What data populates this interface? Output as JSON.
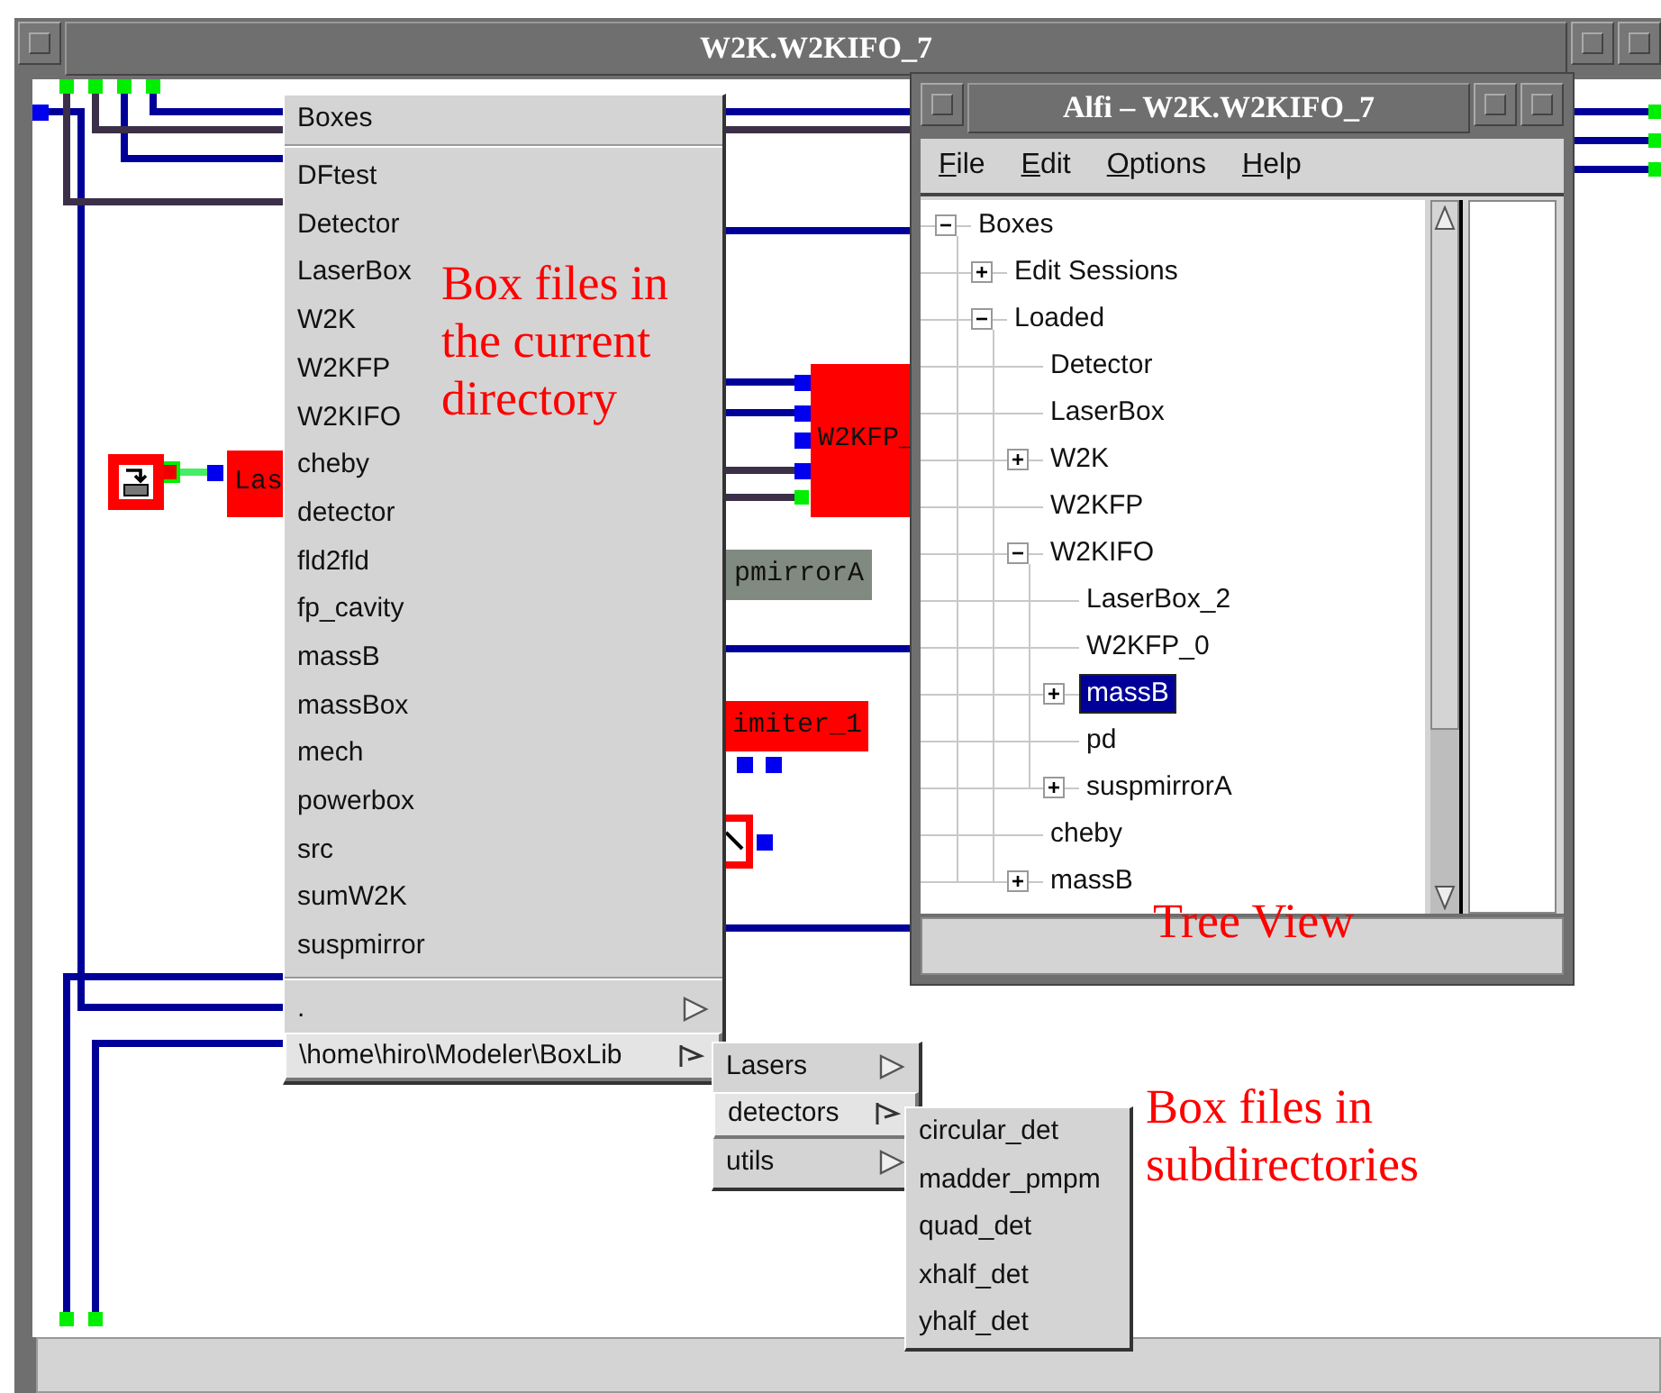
{
  "main_window": {
    "title": "W2K.W2KIFO_7"
  },
  "canvas_blocks": [
    {
      "label": "Las",
      "color": "#ff0000"
    },
    {
      "label": "W2KFP_",
      "color": "#ff0000"
    },
    {
      "label": "pmirrorA",
      "color": "#808a80"
    },
    {
      "label": "imiter_1",
      "color": "#ff0000"
    }
  ],
  "boxes_menu": {
    "title": "Boxes",
    "items": [
      {
        "label": "DFtest",
        "kind": "file",
        "selected": false
      },
      {
        "label": "Detector",
        "kind": "file",
        "selected": false
      },
      {
        "label": "LaserBox",
        "kind": "file",
        "selected": false
      },
      {
        "label": "W2K",
        "kind": "file",
        "selected": false
      },
      {
        "label": "W2KFP",
        "kind": "file",
        "selected": false
      },
      {
        "label": "W2KIFO",
        "kind": "file",
        "selected": false
      },
      {
        "label": "cheby",
        "kind": "file",
        "selected": false
      },
      {
        "label": "detector",
        "kind": "file",
        "selected": false
      },
      {
        "label": "fld2fld",
        "kind": "file",
        "selected": false
      },
      {
        "label": "fp_cavity",
        "kind": "file",
        "selected": false
      },
      {
        "label": "massB",
        "kind": "file",
        "selected": false
      },
      {
        "label": "massBox",
        "kind": "file",
        "selected": false
      },
      {
        "label": "mech",
        "kind": "file",
        "selected": false
      },
      {
        "label": "powerbox",
        "kind": "file",
        "selected": false
      },
      {
        "label": "src",
        "kind": "file",
        "selected": false
      },
      {
        "label": "sumW2K",
        "kind": "file",
        "selected": false
      },
      {
        "label": "suspmirror",
        "kind": "file",
        "selected": false
      },
      {
        "label": ".",
        "kind": "folder",
        "selected": false
      },
      {
        "label": "\\home\\hiro\\Modeler\\BoxLib",
        "kind": "folder",
        "selected": true
      }
    ]
  },
  "folder_submenu": {
    "items": [
      {
        "label": "Lasers",
        "kind": "folder",
        "selected": false
      },
      {
        "label": "detectors",
        "kind": "folder",
        "selected": true
      },
      {
        "label": "utils",
        "kind": "folder",
        "selected": false
      }
    ]
  },
  "detectors_submenu": {
    "items": [
      {
        "label": "circular_det",
        "kind": "file",
        "selected": false
      },
      {
        "label": "madder_pmpm",
        "kind": "file",
        "selected": false
      },
      {
        "label": "quad_det",
        "kind": "file",
        "selected": false
      },
      {
        "label": "xhalf_det",
        "kind": "file",
        "selected": false
      },
      {
        "label": "yhalf_det",
        "kind": "file",
        "selected": false
      }
    ]
  },
  "alfi_window": {
    "title": "Alfi – W2K.W2KIFO_7",
    "menu": [
      "File",
      "Edit",
      "Options",
      "Help"
    ],
    "tree": [
      {
        "label": "Boxes",
        "kind": "branch",
        "expanded": true,
        "selected": false,
        "children": [
          {
            "label": "Edit Sessions",
            "kind": "branch",
            "expanded": false,
            "selected": false
          },
          {
            "label": "Loaded",
            "kind": "branch",
            "expanded": true,
            "selected": false,
            "children": [
              {
                "label": "Detector",
                "kind": "leaf",
                "selected": false
              },
              {
                "label": "LaserBox",
                "kind": "leaf",
                "selected": false
              },
              {
                "label": "W2K",
                "kind": "branch",
                "expanded": false,
                "selected": false
              },
              {
                "label": "W2KFP",
                "kind": "leaf",
                "selected": false
              },
              {
                "label": "W2KIFO",
                "kind": "branch",
                "expanded": true,
                "selected": false,
                "children": [
                  {
                    "label": "LaserBox_2",
                    "kind": "leaf",
                    "selected": false
                  },
                  {
                    "label": "W2KFP_0",
                    "kind": "leaf",
                    "selected": false
                  },
                  {
                    "label": "massB",
                    "kind": "branch",
                    "expanded": false,
                    "selected": true
                  },
                  {
                    "label": "pd",
                    "kind": "leaf",
                    "selected": false
                  },
                  {
                    "label": "suspmirrorA",
                    "kind": "branch",
                    "expanded": false,
                    "selected": false
                  }
                ]
              },
              {
                "label": "cheby",
                "kind": "leaf",
                "selected": false
              },
              {
                "label": "massB",
                "kind": "branch",
                "expanded": false,
                "selected": false
              }
            ]
          }
        ]
      }
    ]
  },
  "annotations": [
    "Box files in\nthe current\ndirectory",
    "Tree View",
    "Box files in\nsubdirectories"
  ]
}
